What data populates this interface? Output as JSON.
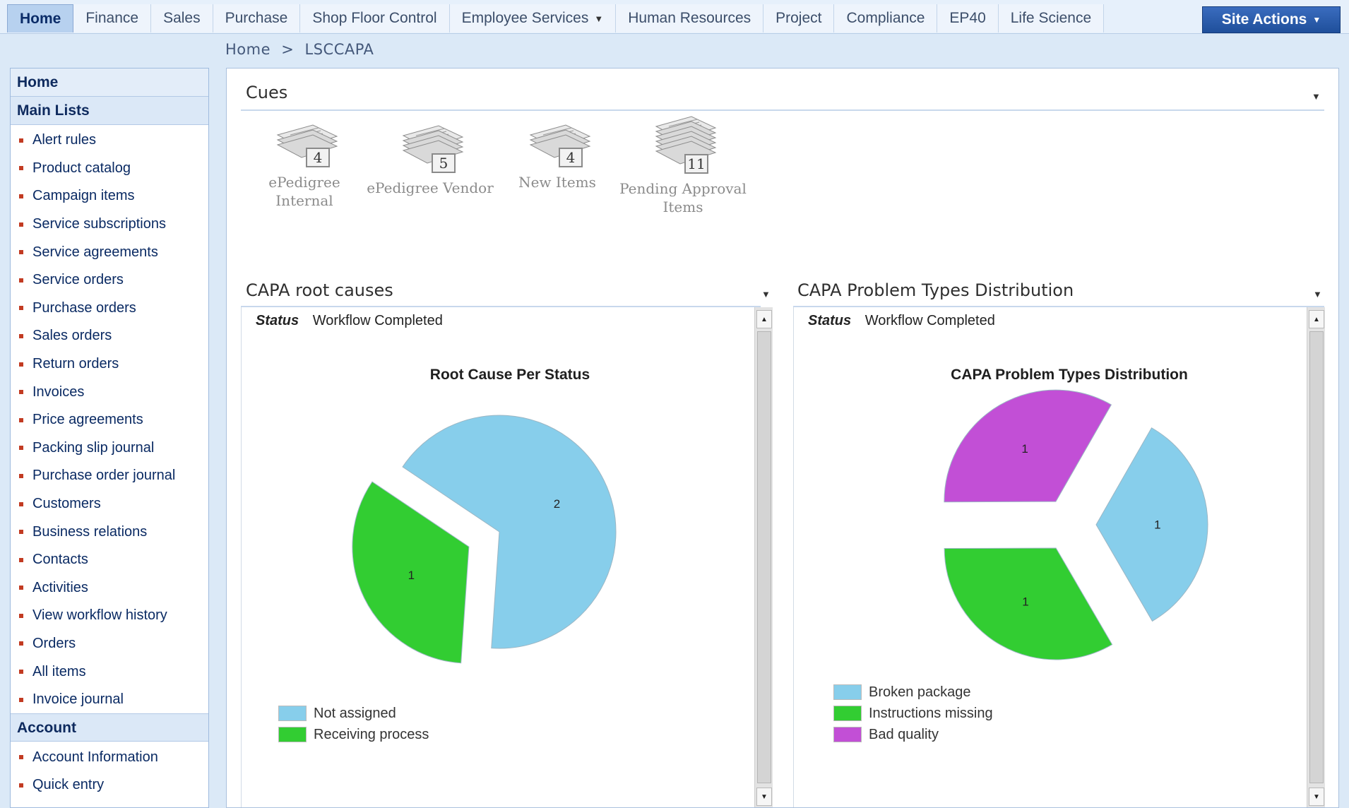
{
  "nav": {
    "tabs": [
      {
        "label": "Home",
        "active": true
      },
      {
        "label": "Finance"
      },
      {
        "label": "Sales"
      },
      {
        "label": "Purchase"
      },
      {
        "label": "Shop Floor Control"
      },
      {
        "label": "Employee Services",
        "has_dropdown": true
      },
      {
        "label": "Human Resources"
      },
      {
        "label": "Project"
      },
      {
        "label": "Compliance"
      },
      {
        "label": "EP40"
      },
      {
        "label": "Life Science"
      }
    ],
    "site_actions": "Site Actions"
  },
  "breadcrumb": {
    "root": "Home",
    "sep": ">",
    "current": "LSCCAPA"
  },
  "leftnav": {
    "home": "Home",
    "main_lists_header": "Main Lists",
    "main_lists": [
      "Alert rules",
      "Product catalog",
      "Campaign items",
      "Service subscriptions",
      "Service agreements",
      "Service orders",
      "Purchase orders",
      "Sales orders",
      "Return orders",
      "Invoices",
      "Price agreements",
      "Packing slip journal",
      "Purchase order journal",
      "Customers",
      "Business relations",
      "Contacts",
      "Activities",
      "View workflow history",
      "Orders",
      "All items",
      "Invoice journal"
    ],
    "account_header": "Account",
    "account_items": [
      "Account Information",
      "Quick entry"
    ]
  },
  "cues": {
    "title": "Cues",
    "items": [
      {
        "label": "ePedigree Internal",
        "count": "4"
      },
      {
        "label": "ePedigree Vendor",
        "count": "5"
      },
      {
        "label": "New Items",
        "count": "4"
      },
      {
        "label": "Pending Approval Items",
        "count": "11"
      }
    ]
  },
  "parts": {
    "left": {
      "title": "CAPA root causes",
      "status_key": "Status",
      "status_value": "Workflow Completed"
    },
    "right": {
      "title": "CAPA Problem Types Distribution",
      "status_key": "Status",
      "status_value": "Workflow Completed"
    }
  },
  "chart_data": [
    {
      "type": "pie",
      "title": "Root Cause Per Status",
      "categories": [
        "Not assigned",
        "Receiving process"
      ],
      "values": [
        2,
        1
      ],
      "colors": [
        "#87ceeb",
        "#32cd32"
      ],
      "legend": "bottom-left",
      "exploded": true
    },
    {
      "type": "pie",
      "title": "CAPA Problem Types Distribution",
      "categories": [
        "Broken package",
        "Instructions missing",
        "Bad quality"
      ],
      "values": [
        1,
        1,
        1
      ],
      "colors": [
        "#87ceeb",
        "#32cd32",
        "#c24fd6"
      ],
      "legend": "bottom-left",
      "exploded": true
    }
  ]
}
